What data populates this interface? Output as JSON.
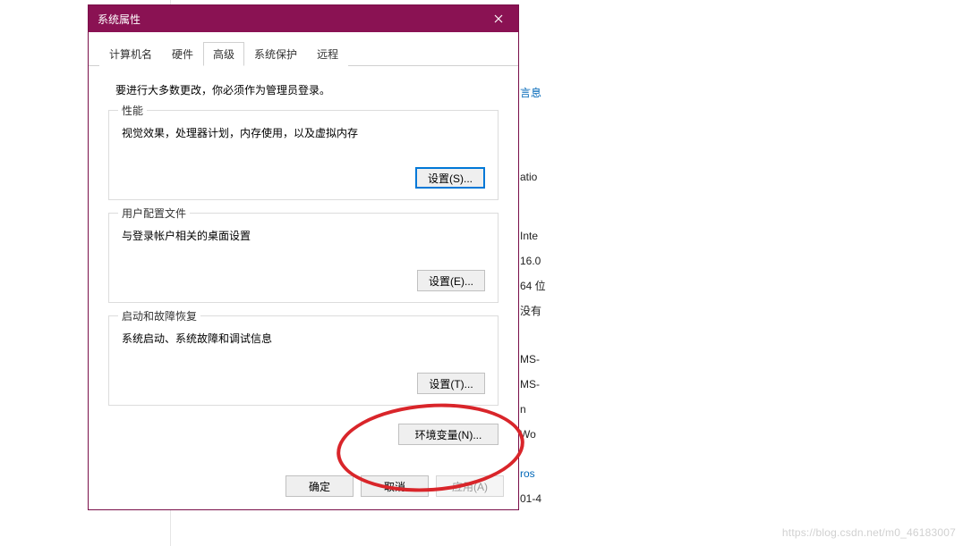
{
  "window": {
    "title": "系统属性"
  },
  "tabs": {
    "computer_name": "计算机名",
    "hardware": "硬件",
    "advanced": "高级",
    "system_protection": "系统保护",
    "remote": "远程"
  },
  "intro": "要进行大多数更改，你必须作为管理员登录。",
  "groups": {
    "performance": {
      "legend": "性能",
      "desc": "视觉效果，处理器计划，内存使用，以及虚拟内存",
      "button": "设置(S)..."
    },
    "user_profiles": {
      "legend": "用户配置文件",
      "desc": "与登录帐户相关的桌面设置",
      "button": "设置(E)..."
    },
    "startup_recovery": {
      "legend": "启动和故障恢复",
      "desc": "系统启动、系统故障和调试信息",
      "button": "设置(T)..."
    }
  },
  "env_button": "环境变量(N)...",
  "dialog_buttons": {
    "ok": "确定",
    "cancel": "取消",
    "apply": "应用(A)"
  },
  "background": {
    "link1": "言息",
    "r1": "atio",
    "r2": "Inte",
    "r3": "16.0",
    "r4": "64 位",
    "r5": "没有",
    "r6": "MS-",
    "r7": "MS-",
    "r8": "n",
    "r9": "Wo",
    "link2": "ros",
    "r10": "01-4"
  },
  "watermark": "https://blog.csdn.net/m0_46183007"
}
